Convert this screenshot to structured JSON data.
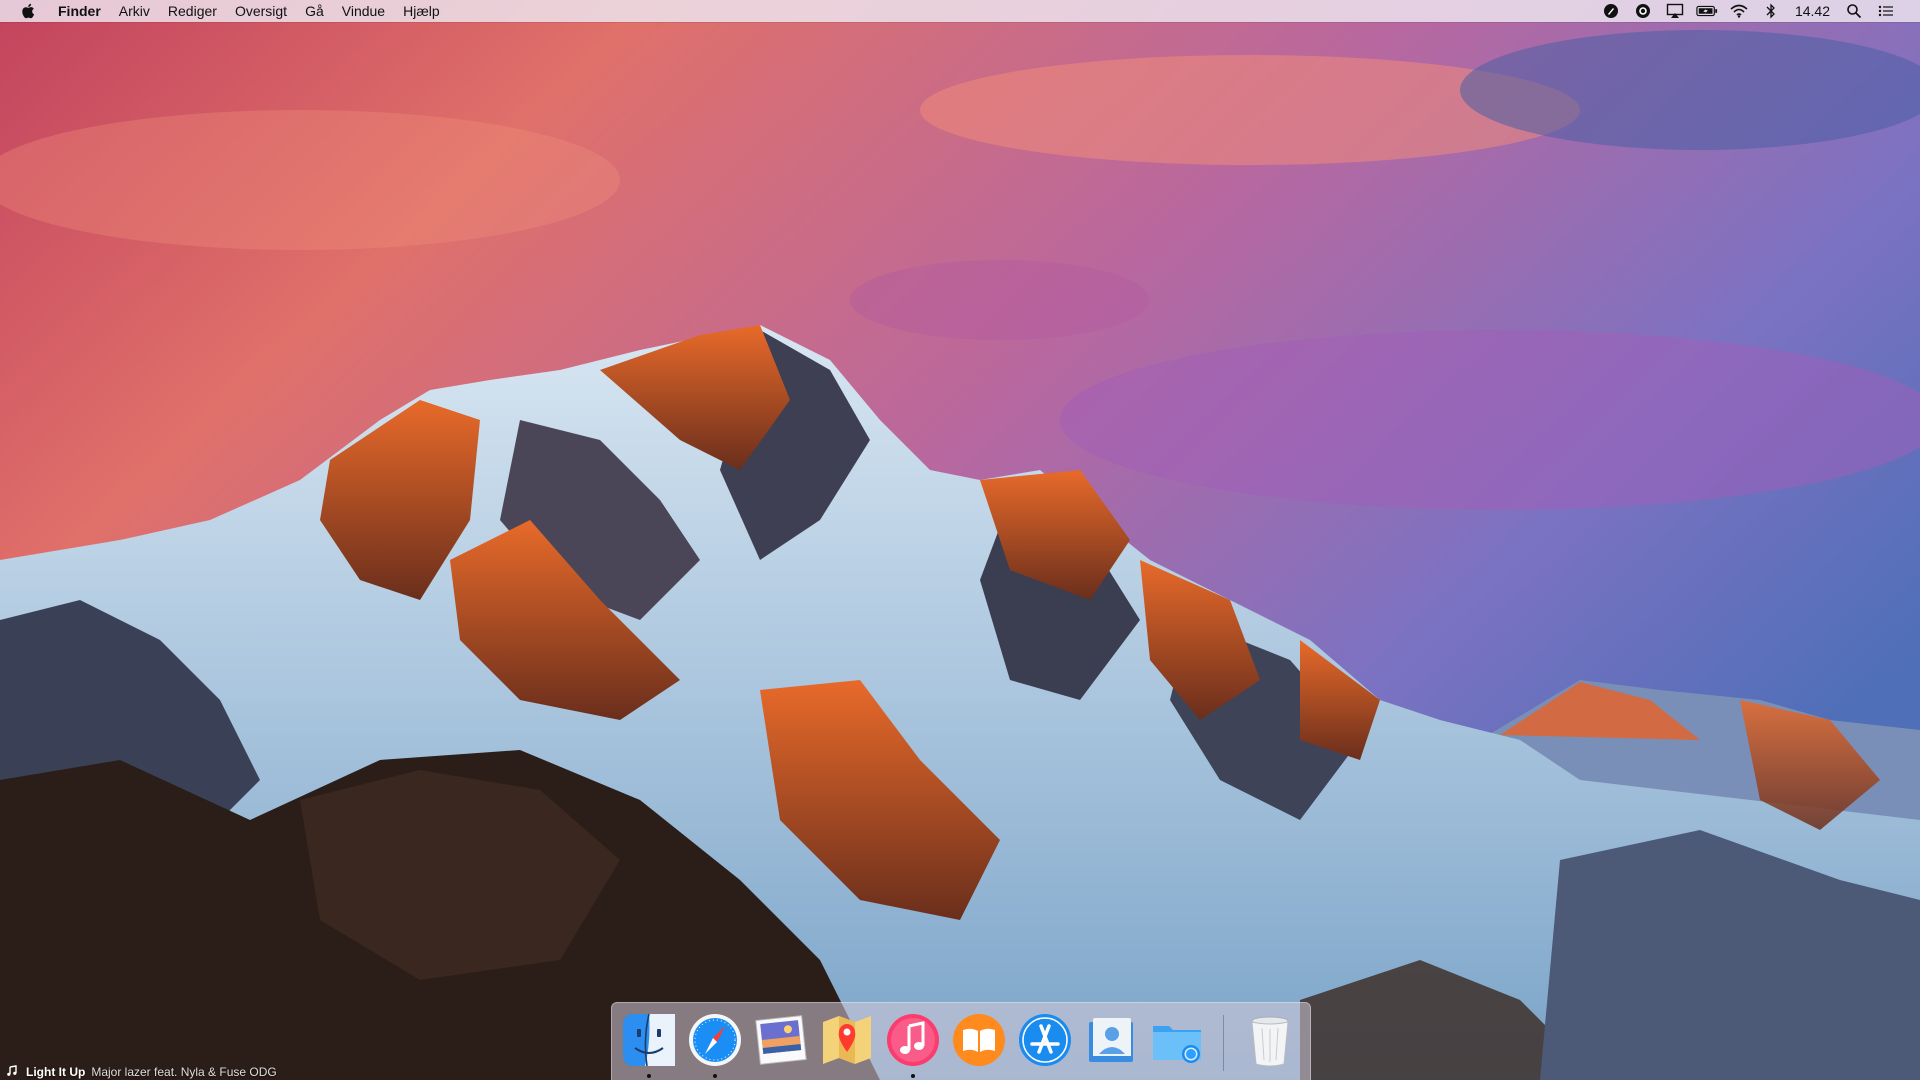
{
  "menubar": {
    "app_name": "Finder",
    "items": [
      "Arkiv",
      "Rediger",
      "Oversigt",
      "Gå",
      "Vindue",
      "Hjælp"
    ],
    "clock": "14.42"
  },
  "status_icons": [
    "pen-icon",
    "ring-icon",
    "airplay-icon",
    "battery-icon",
    "wifi-icon",
    "bluetooth-icon",
    "spotlight-icon",
    "notification-center-icon"
  ],
  "dock": {
    "items": [
      "finder-icon",
      "safari-icon",
      "photos-icon",
      "maps-icon",
      "itunes-icon",
      "ibooks-icon",
      "app-store-icon",
      "contacts-icon",
      "folder-icon",
      "trash-icon"
    ],
    "running": [
      "finder",
      "safari",
      "itunes"
    ]
  },
  "now_playing": {
    "title": "Light It Up",
    "artist": "Major lazer feat. Nyla & Fuse ODG"
  },
  "colors": {
    "menubar_bg": "#eee6f0",
    "sky_top": "#c9506a",
    "sky_mid": "#8c6cb6",
    "peak_light": "#e2642e"
  }
}
